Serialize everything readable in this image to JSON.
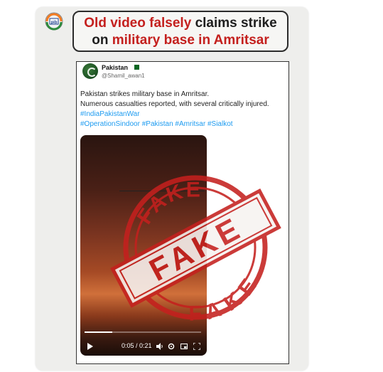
{
  "header": {
    "title_part1": "Old video falsely",
    "title_part2": "claims strike",
    "title_part3": "on",
    "title_part4": "military base in Amritsar"
  },
  "tweet": {
    "author_name": "Pakistan",
    "author_handle": "@Shamil_awan1",
    "line1": "Pakistan strikes military base in Amritsar.",
    "line2": "Numerous casualties reported, with several critically injured.",
    "hashtag_line1": "#IndiaPakistanWar",
    "hashtag_line2": "#OperationSindoor #Pakistan #Amritsar #Sialkot"
  },
  "video": {
    "time": "0:05 / 0:21",
    "progress": 0.24
  },
  "stamp": {
    "top_text": "FAKE",
    "center_text": "FAKE",
    "bottom_text": "FAKE",
    "color": "#c4201e"
  },
  "icons": [
    "pib-logo-icon",
    "play-icon",
    "volume-icon",
    "settings-icon",
    "pip-icon",
    "fullscreen-icon"
  ]
}
